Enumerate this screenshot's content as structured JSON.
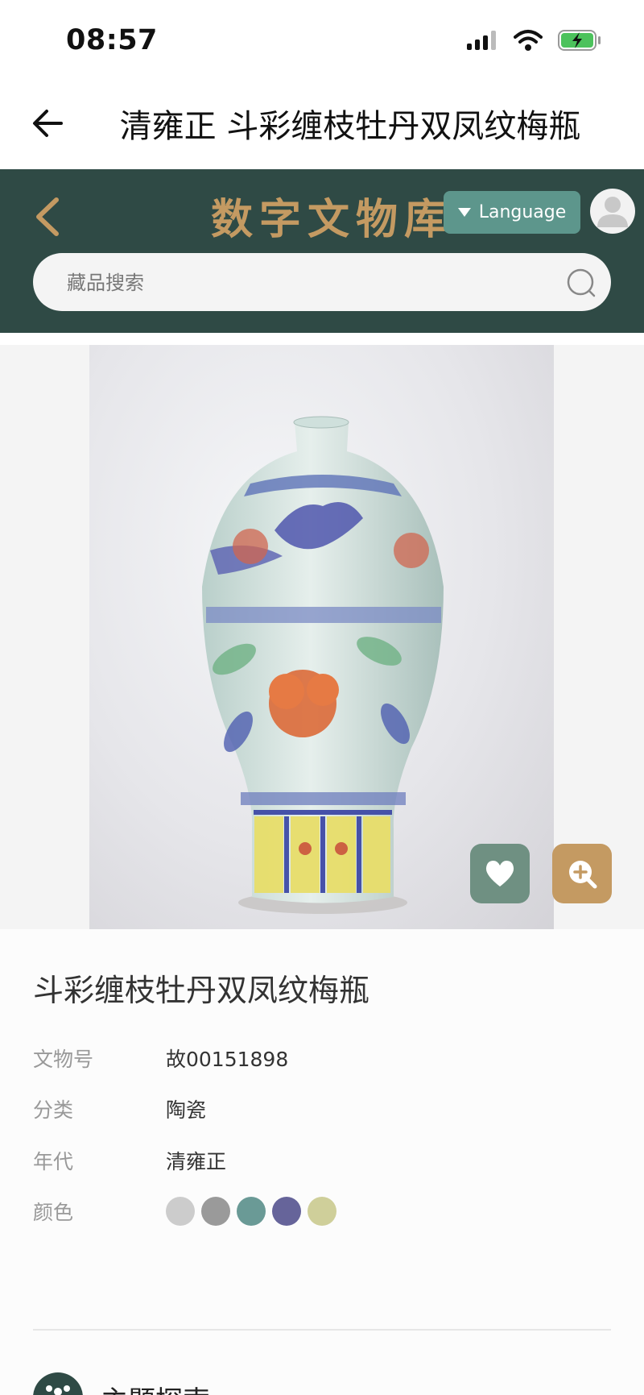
{
  "status_bar": {
    "time": "08:57"
  },
  "nav": {
    "title": "清雍正 斗彩缠枝牡丹双凤纹梅瓶"
  },
  "header": {
    "site_title": "数字文物库",
    "language_label": "Language",
    "search_placeholder": "藏品搜索"
  },
  "artifact": {
    "title": "斗彩缠枝牡丹双凤纹梅瓶",
    "fields": [
      {
        "label": "文物号",
        "value": "故00151898"
      },
      {
        "label": "分类",
        "value": "陶瓷"
      },
      {
        "label": "年代",
        "value": "清雍正"
      }
    ],
    "color_label": "颜色",
    "colors": [
      "#cccccc",
      "#9a9a9a",
      "#6a9a96",
      "#66649a",
      "#cfcf9a"
    ]
  },
  "section": {
    "title": "主题探索"
  },
  "theme": {
    "header_bg": "#2f4a45",
    "accent_gold": "#c49a62",
    "accent_teal": "#5d968c",
    "favorite_green": "#6f9082"
  }
}
